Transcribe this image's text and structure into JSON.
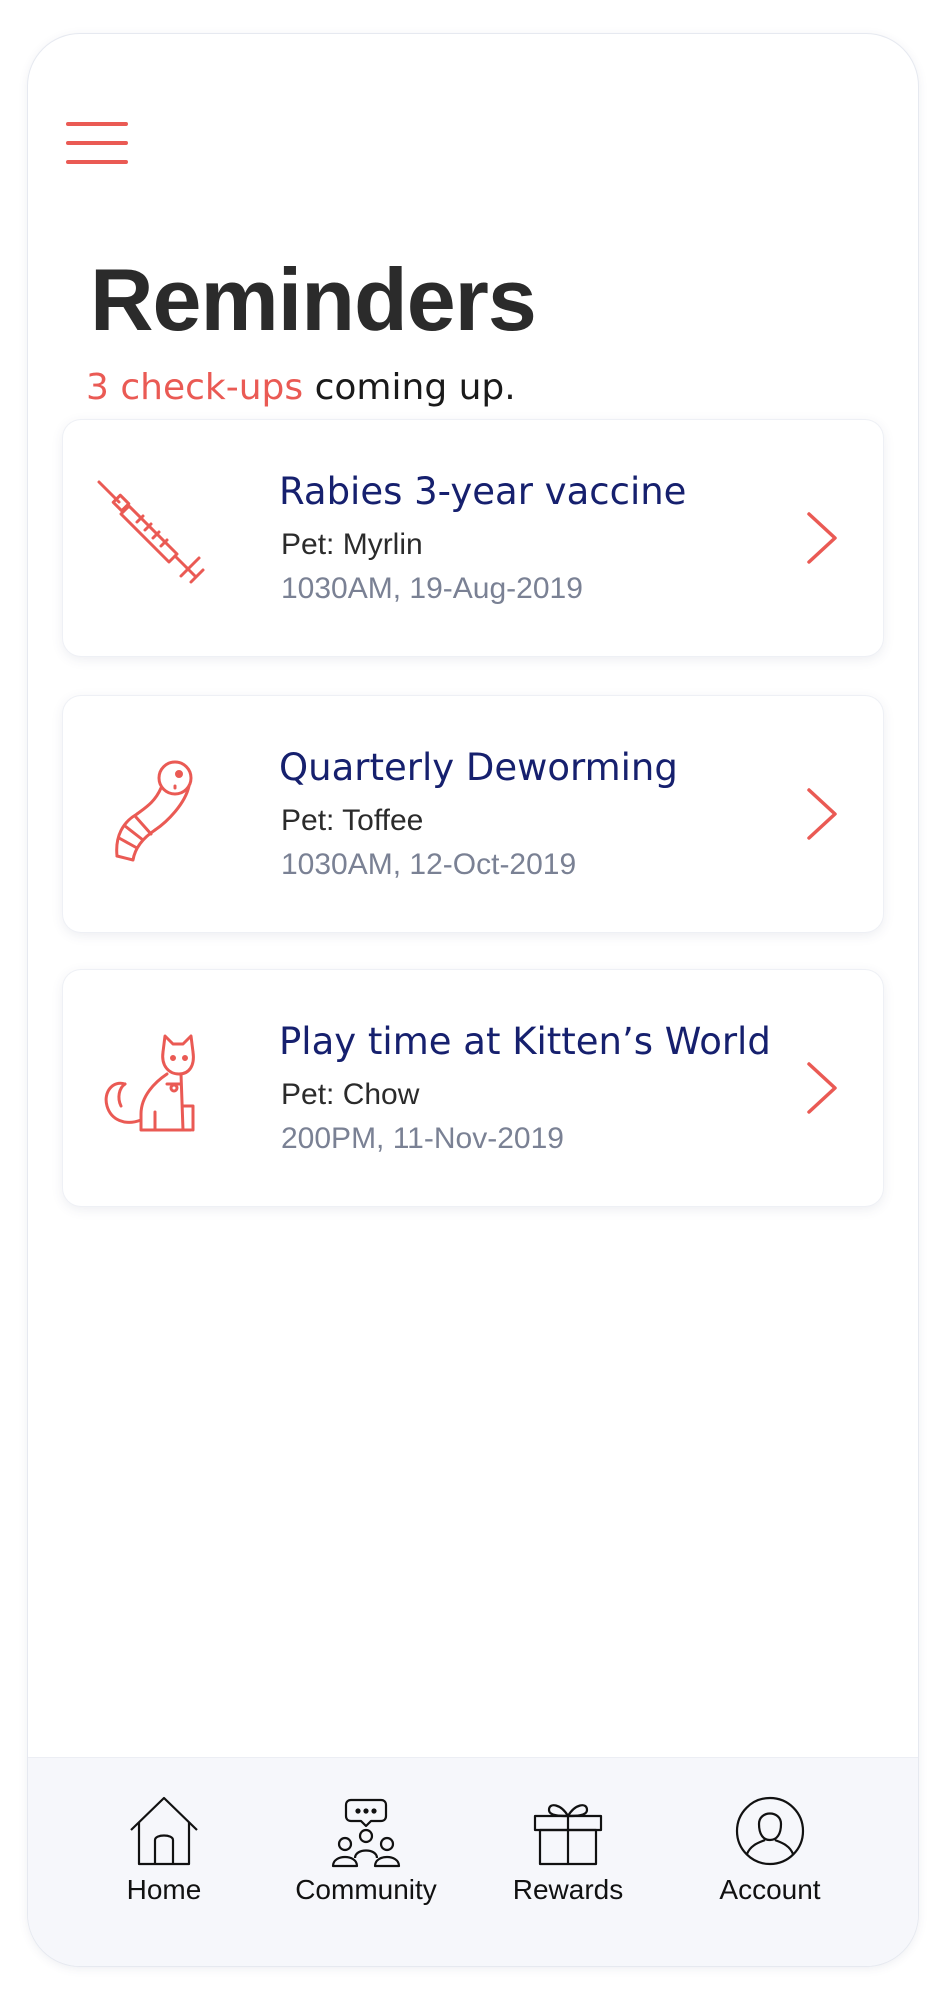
{
  "header": {
    "menu_icon": "hamburger-menu-icon",
    "title": "Reminders",
    "subtitle_count": "3 check-ups",
    "subtitle_rest": " coming up."
  },
  "reminders": [
    {
      "icon": "syringe-icon",
      "title": "Rabies 3-year vaccine",
      "pet": "Pet: Myrlin",
      "datetime": "1030AM, 19-Aug-2019"
    },
    {
      "icon": "worm-icon",
      "title": "Quarterly Deworming",
      "pet": "Pet: Toffee",
      "datetime": "1030AM, 12-Oct-2019"
    },
    {
      "icon": "cat-icon",
      "title": "Play time at Kitten’s World",
      "pet": "Pet: Chow",
      "datetime": "200PM, 11-Nov-2019"
    }
  ],
  "nav": [
    {
      "icon": "home-icon",
      "label": "Home"
    },
    {
      "icon": "community-icon",
      "label": "Community"
    },
    {
      "icon": "gift-icon",
      "label": "Rewards"
    },
    {
      "icon": "account-icon",
      "label": "Account"
    }
  ],
  "colors": {
    "accent": "#ea5a54",
    "title_text": "#2b2b2b",
    "card_title": "#16206e",
    "muted_text": "#7a8194",
    "nav_background": "#f6f7fb"
  }
}
